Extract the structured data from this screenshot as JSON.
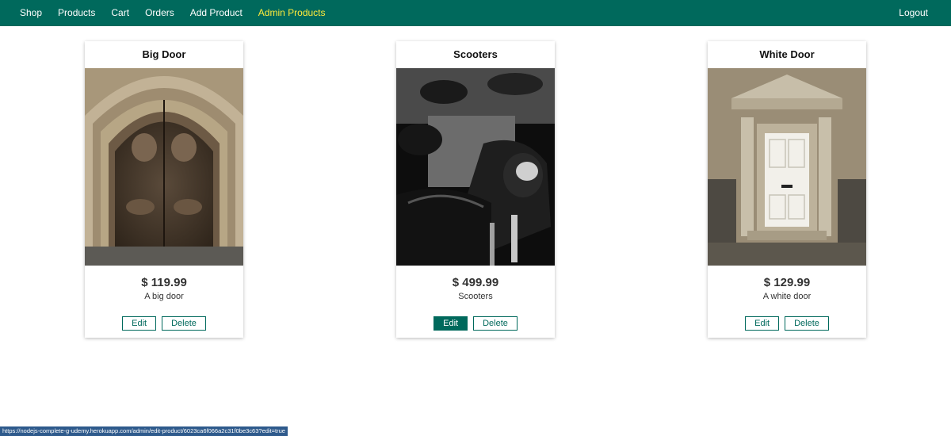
{
  "nav": {
    "items": [
      {
        "label": "Shop",
        "active": false
      },
      {
        "label": "Products",
        "active": false
      },
      {
        "label": "Cart",
        "active": false
      },
      {
        "label": "Orders",
        "active": false
      },
      {
        "label": "Add Product",
        "active": false
      },
      {
        "label": "Admin Products",
        "active": true
      }
    ],
    "logout_label": "Logout"
  },
  "colors": {
    "primary": "#00695c",
    "active_nav": "#ffeb3b",
    "status_bar": "#2e5a8c"
  },
  "products": [
    {
      "title": "Big Door",
      "price": "$ 119.99",
      "description": "A big door",
      "edit_label": "Edit",
      "delete_label": "Delete",
      "edit_hovered": false,
      "image": "door-arch-photo"
    },
    {
      "title": "Scooters",
      "price": "$ 499.99",
      "description": "Scooters",
      "edit_label": "Edit",
      "delete_label": "Delete",
      "edit_hovered": true,
      "image": "scooters-photo"
    },
    {
      "title": "White Door",
      "price": "$ 129.99",
      "description": "A white door",
      "edit_label": "Edit",
      "delete_label": "Delete",
      "edit_hovered": false,
      "image": "white-door-photo"
    }
  ],
  "status_url": "https://nodejs-complete-g-udemy.herokuapp.com/admin/edit-product/6023ca6f066a2c31f0be3c63?edit=true"
}
